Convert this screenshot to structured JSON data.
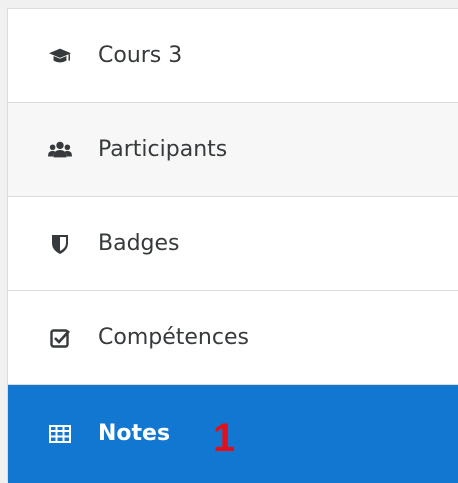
{
  "nav": {
    "items": [
      {
        "label": "Cours 3",
        "icon": "graduation-cap-icon"
      },
      {
        "label": "Participants",
        "icon": "users-icon"
      },
      {
        "label": "Badges",
        "icon": "shield-icon"
      },
      {
        "label": "Compétences",
        "icon": "check-square-icon"
      },
      {
        "label": "Notes",
        "icon": "table-icon",
        "active": true
      }
    ]
  },
  "annotation": {
    "marker": "1"
  },
  "colors": {
    "active_bg": "#1177d1",
    "marker": "#e3101a",
    "text": "#373a3c"
  }
}
